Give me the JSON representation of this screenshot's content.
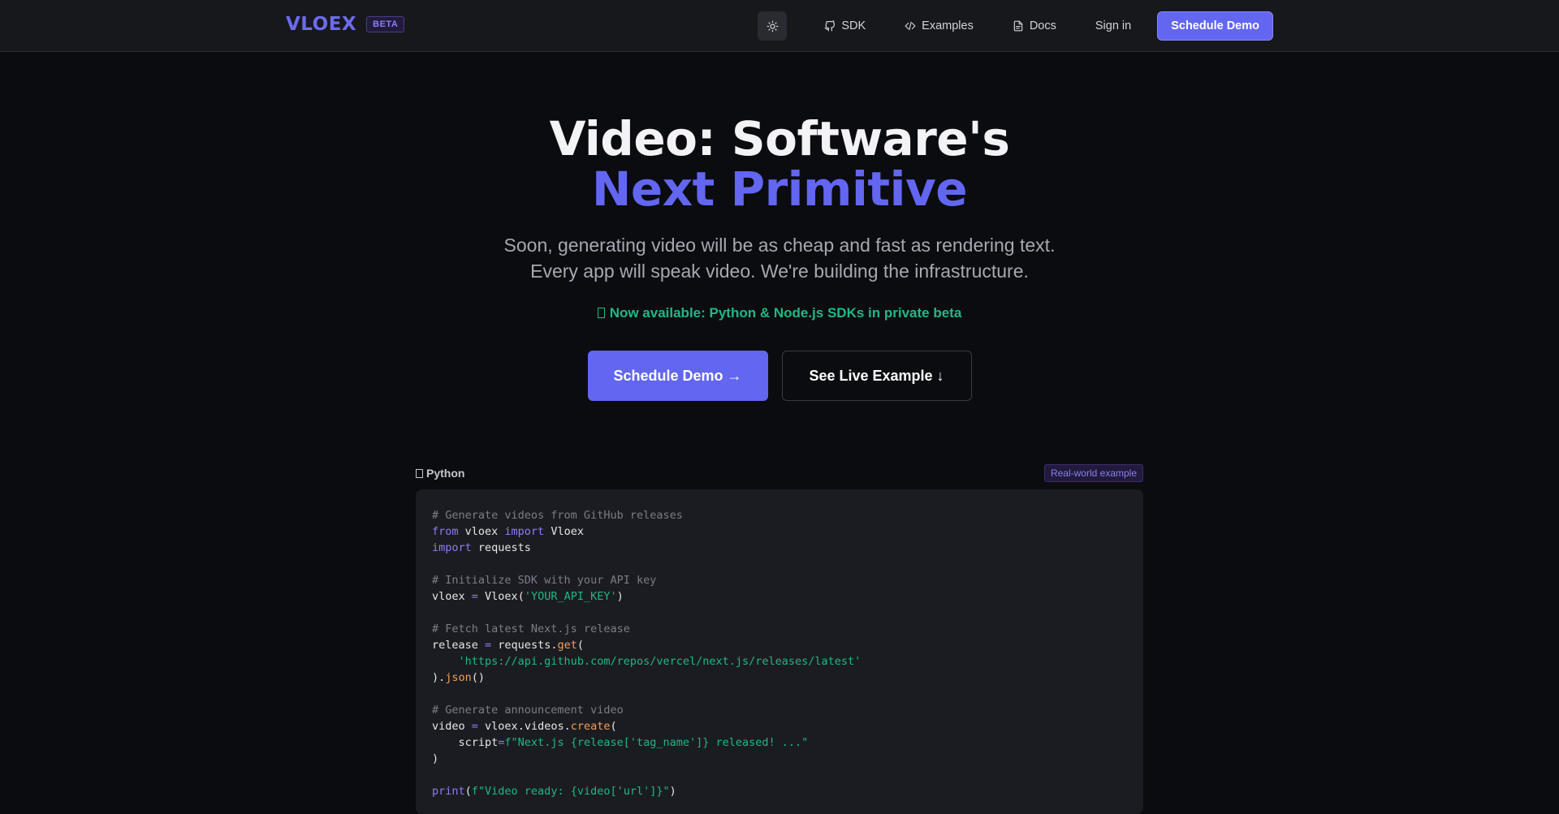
{
  "header": {
    "logo": "VLOEX",
    "badge": "BETA",
    "nav": [
      {
        "label": "SDK",
        "icon": "github-icon"
      },
      {
        "label": "Examples",
        "icon": "code-icon"
      },
      {
        "label": "Docs",
        "icon": "document-icon"
      },
      {
        "label": "Sign in"
      }
    ],
    "cta": "Schedule Demo"
  },
  "hero": {
    "title_line1": "Video: Software's",
    "title_line2": "Next Primitive",
    "subtitle_line1": "Soon, generating video will be as cheap and fast as rendering text.",
    "subtitle_line2": "Every app will speak video. We're building the infrastructure.",
    "availability": "Now available: Python & Node.js SDKs in private beta",
    "primary_cta": "Schedule Demo →",
    "secondary_cta": "See Live Example ↓"
  },
  "code": {
    "language": "Python",
    "tag": "Real-world example",
    "lines": [
      [
        {
          "t": "# Generate videos from GitHub releases",
          "c": "c"
        }
      ],
      [
        {
          "t": "from",
          "c": "k"
        },
        {
          "t": " vloex "
        },
        {
          "t": "import",
          "c": "k"
        },
        {
          "t": " Vloex"
        }
      ],
      [
        {
          "t": "import",
          "c": "k"
        },
        {
          "t": " requests"
        }
      ],
      [],
      [
        {
          "t": "# Initialize SDK with your API key",
          "c": "c"
        }
      ],
      [
        {
          "t": "vloex "
        },
        {
          "t": "=",
          "c": "o"
        },
        {
          "t": " Vloex("
        },
        {
          "t": "'YOUR_API_KEY'",
          "c": "s"
        },
        {
          "t": ")"
        }
      ],
      [],
      [
        {
          "t": "# Fetch latest Next.js release",
          "c": "c"
        }
      ],
      [
        {
          "t": "release "
        },
        {
          "t": "=",
          "c": "o"
        },
        {
          "t": " requests."
        },
        {
          "t": "get",
          "c": "f"
        },
        {
          "t": "("
        }
      ],
      [
        {
          "t": "    "
        },
        {
          "t": "'https://api.github.com/repos/vercel/next.js/releases/latest'",
          "c": "s"
        }
      ],
      [
        {
          "t": ")."
        },
        {
          "t": "json",
          "c": "f"
        },
        {
          "t": "()"
        }
      ],
      [],
      [
        {
          "t": "# Generate announcement video",
          "c": "c"
        }
      ],
      [
        {
          "t": "video "
        },
        {
          "t": "=",
          "c": "o"
        },
        {
          "t": " vloex.videos."
        },
        {
          "t": "create",
          "c": "f"
        },
        {
          "t": "("
        }
      ],
      [
        {
          "t": "    script"
        },
        {
          "t": "=",
          "c": "o"
        },
        {
          "t": "f\"Next.js {release['tag_name']} released! ...\"",
          "c": "s"
        }
      ],
      [
        {
          "t": ")"
        }
      ],
      [],
      [
        {
          "t": "print",
          "c": "k"
        },
        {
          "t": "("
        },
        {
          "t": "f\"Video ready: {video['url']}\"",
          "c": "s"
        },
        {
          "t": ")"
        }
      ]
    ]
  },
  "colors": {
    "accent": "#6366f1",
    "success": "#1fb885",
    "background": "#0b0c0f"
  }
}
